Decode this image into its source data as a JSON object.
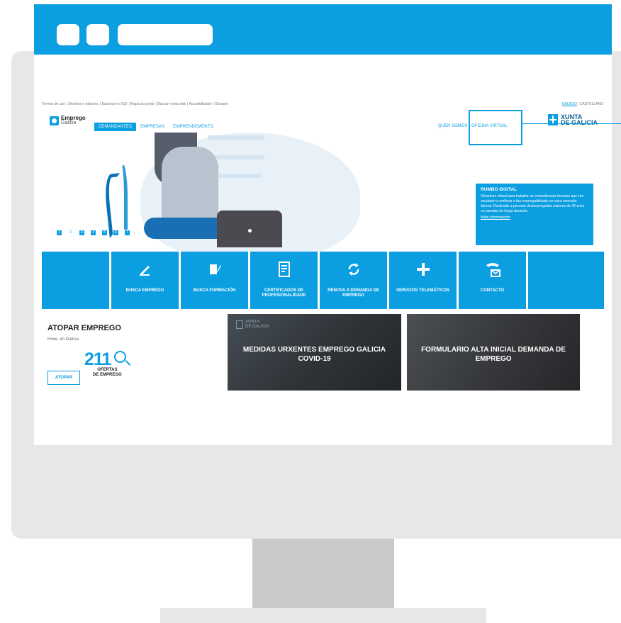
{
  "util_links": [
    "Termos de uso",
    "Dereitos e deberes",
    "Estamos no 012",
    "Mapa do portal",
    "Buscar nesta web",
    "Accesibilidade",
    "Glosario"
  ],
  "languages": {
    "active": "GALEGO",
    "other": "CASTELLANO"
  },
  "logo": {
    "line1": "Emprego",
    "line2": "Galicia"
  },
  "nav": {
    "tabs": [
      "DEMANDANTES",
      "EMPRESAS",
      "EMPRENDEMENTO"
    ],
    "active_index": 0
  },
  "right_nav": {
    "items": [
      "QUEN SOMOS",
      "OFICINA VIRTUAL"
    ]
  },
  "xunta_logo": {
    "line1": "XUNTA",
    "line2": "DE GALICIA"
  },
  "carousel": {
    "dots": [
      "1",
      "2",
      "3",
      "4",
      "5",
      "6",
      "7"
    ],
    "active_index": 1
  },
  "promo": {
    "title": "RUMBO DIXITAL",
    "body": "Obradoiro virtual para traballar as competencias brandas que che axudarán a mellorar a túa empregabilidade no novo mercado laboral. Destinado a persoas desempregadas maiores de 45 anos ou paradas de longa duración.",
    "link": "Máis información"
  },
  "tiles": [
    {
      "icon": "",
      "label": ""
    },
    {
      "icon": "pen-writing-icon",
      "label": "BUSCA EMPREGO"
    },
    {
      "icon": "book-pen-icon",
      "label": "BUSCA FORMACIÓN"
    },
    {
      "icon": "certificate-document-icon",
      "label": "CERTIFICADOS DE PROFESIONALIDADE"
    },
    {
      "icon": "renew-arrows-icon",
      "label": "RENOVA A DEMANDA DE EMPREGO"
    },
    {
      "icon": "plus-icon",
      "label": "SERVIZOS TELEMÁTICOS"
    },
    {
      "icon": "phone-mail-icon",
      "label": "CONTACTO"
    },
    {
      "icon": "",
      "label": ""
    }
  ],
  "atopar": {
    "title": "ATOPAR EMPREGO",
    "subtitle": "Hoxe, en Galicia",
    "count": "211",
    "count_label_1": "OFERTAS",
    "count_label_2": "DE EMPREGO",
    "button": "ATOPAR"
  },
  "cards": [
    {
      "title": "MEDIDAS URXENTES EMPREGO GALICIA COVID-19",
      "badge_line1": "XUNTA",
      "badge_line2": "DE GALICIA"
    },
    {
      "title": "FORMULARIO ALTA INICIAL DEMANDA DE EMPREGO"
    }
  ],
  "colors": {
    "accent": "#0b9ee0",
    "frame": "#e7e7e7",
    "stand": "#c9c9c9"
  }
}
